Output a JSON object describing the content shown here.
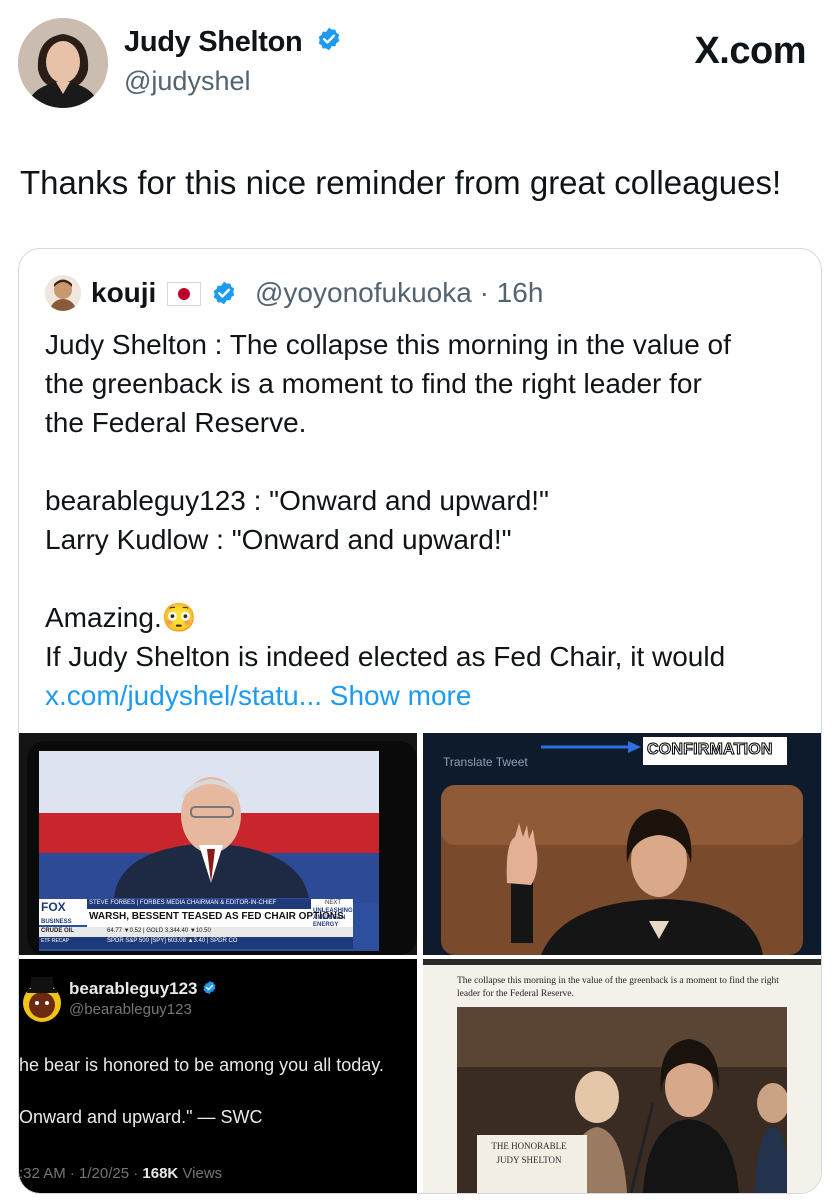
{
  "author": {
    "name": "Judy Shelton",
    "handle": "@judyshel",
    "verified_color": "#1d9bf0"
  },
  "brand": "X.com",
  "tweet_text": "Thanks for this nice reminder from great colleagues!",
  "quote": {
    "name": "kouji",
    "handle": "@yoyonofukuoka",
    "separator": "·",
    "time": "16h",
    "lines": [
      "Judy Shelton : The collapse this morning in the value of",
      "the greenback is a moment to find the right leader for",
      "the Federal Reserve."
    ],
    "lines2": [
      "bearableguy123 : \"Onward and upward!\"",
      "Larry Kudlow : \"Onward and upward!\""
    ],
    "amazing": "Amazing.",
    "emoji": "😳",
    "last_line": "If Judy Shelton is indeed elected as Fed Chair, it would",
    "link": "x.com/judyshel/statu...",
    "show_more": "Show more"
  },
  "media": {
    "tv": {
      "ticker_name": "STEVE FORBES | FORBES MEDIA CHAIRMAN & EDITOR-IN-CHIEF",
      "headline": "WARSH, BESSENT TEASED AS FED CHAIR OPTIONS",
      "next_label": "NEXT",
      "next_text": "UNLEASHING AMERICAN ENERGY",
      "network": "FOX",
      "network_sub": "BUSINESS",
      "ticker_left": "CRUDE OIL",
      "ticker_left_sub": "ETF RECAP",
      "ticker_values": "64.77 ▼0.52 | GOLD 3,344.40 ▼10.50",
      "ticker_values2": "SPDR S&P 500 [SPY] 603.08 ▲3.40 | SPDR CO"
    },
    "confirmation": {
      "translate": "Translate Tweet",
      "label": "CONFIRMATION"
    },
    "bear_post": {
      "name": "bearableguy123",
      "handle": "@bearableguy123",
      "line1": "he bear is honored to be among you all today.",
      "line2": "Onward and upward.\" — SWC",
      "meta_time": ":32 AM · 1/20/25 · ",
      "views_count": "168K",
      "views_label": " Views"
    },
    "article": {
      "caption": "The collapse this morning in the value of the greenback is a moment to find the right leader for the Federal Reserve.",
      "nameplate1": "THE HONORABLE",
      "nameplate2": "JUDY SHELTON"
    }
  }
}
